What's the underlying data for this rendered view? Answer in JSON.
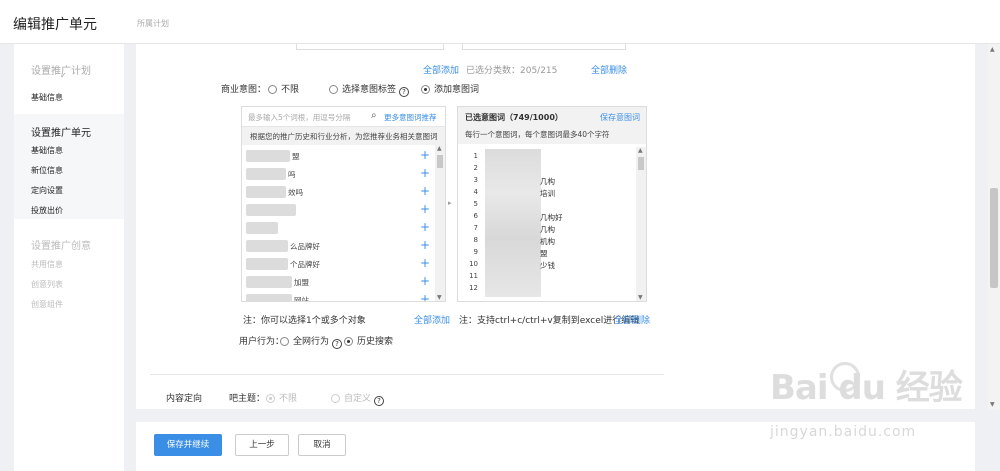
{
  "page": {
    "title": "编辑推广单元",
    "plan_label": "所属计划"
  },
  "sidebar": {
    "sec1": "设置推广计划",
    "sec1_items": [
      "基础信息"
    ],
    "sec2": "设置推广单元",
    "sec2_items": [
      "基础信息",
      "新位信息",
      "定向设置",
      "投放出价"
    ],
    "sec3": "设置推广创意",
    "sec3_items": [
      "共用信息",
      "创意列表",
      "创意组件"
    ],
    "check": "✓"
  },
  "top": {
    "add_all": "全部添加",
    "selected_count": "已选分类数：205/215",
    "delete_all": "全部删除"
  },
  "intent": {
    "label": "商业意图：",
    "options": [
      {
        "label": "不限",
        "checked": false
      },
      {
        "label": "选择意图标签",
        "checked": false
      },
      {
        "label": "添加意图词",
        "checked": true
      }
    ],
    "help": "?"
  },
  "left_panel": {
    "search_placeholder": "最多输入5个词根，用逗号分隔",
    "more_link": "更多意图词推荐",
    "hint": "根据您的推广历史和行业分析，为您推荐业务相关意图词",
    "keywords": [
      "盟",
      "吗",
      "效吗",
      "",
      "",
      "么品牌好",
      "个品牌好",
      "加盟",
      "网站"
    ],
    "plus": "+",
    "footer_note": "注：你可以选择1个或多个对象",
    "add_all": "全部添加"
  },
  "right_panel": {
    "title": "已选意图词（749/1000）",
    "save": "保存意图词",
    "subtitle": "每行一个意图词，每个意图词最多40个字符",
    "lines": [
      {
        "n": "1",
        "t": ""
      },
      {
        "n": "2",
        "t": ""
      },
      {
        "n": "3",
        "t": "几构"
      },
      {
        "n": "4",
        "t": "培训"
      },
      {
        "n": "5",
        "t": ""
      },
      {
        "n": "6",
        "t": "几构好"
      },
      {
        "n": "7",
        "t": "几构"
      },
      {
        "n": "8",
        "t": "机构"
      },
      {
        "n": "9",
        "t": "盟"
      },
      {
        "n": "10",
        "t": "少钱"
      },
      {
        "n": "11",
        "t": ""
      },
      {
        "n": "12",
        "t": ""
      }
    ],
    "footer_note": "注：支持ctrl+c/ctrl+v复制到excel进行编辑",
    "delete_all": "全部删除"
  },
  "behavior": {
    "label": "用户行为：",
    "options": [
      {
        "label": "全网行为",
        "checked": false
      },
      {
        "label": "历史搜索",
        "checked": true
      }
    ]
  },
  "content": {
    "label": "内容定向",
    "topic_label": "吧主题：",
    "options": [
      {
        "label": "不限",
        "checked": true
      },
      {
        "label": "自定义",
        "checked": false
      }
    ]
  },
  "footer": {
    "save_continue": "保存并继续",
    "prev": "上一步",
    "cancel": "取消"
  },
  "watermark": {
    "logo": "Bai du 经验",
    "url": "jingyan.baidu.com"
  },
  "colors": {
    "accent": "#3a8ee6"
  }
}
